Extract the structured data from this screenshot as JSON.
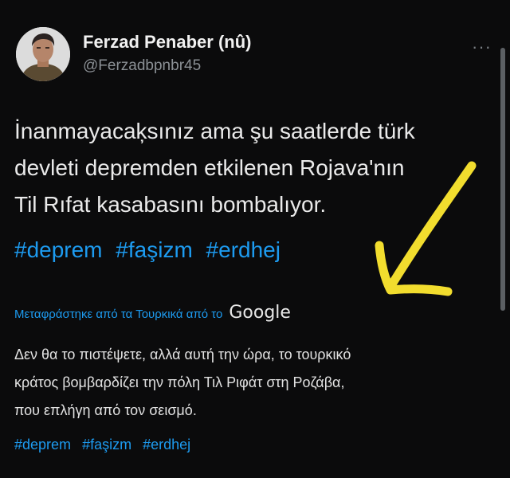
{
  "author": {
    "name": "Ferzad Penaber (nû)",
    "handle": "@Ferzadbpnbr45"
  },
  "menu": {
    "more_label": "···"
  },
  "tweet": {
    "lines": [
      "İnanmayacaķsınız ama şu saatlerde türk",
      "devleti depremden etkilenen Rojava'nın",
      "Til Rıfat kasabasını bombalıyor."
    ],
    "hashtags": [
      "#deprem",
      "#faşizm",
      "#erdhej"
    ]
  },
  "translation": {
    "source_label": "Μεταφράστηκε από τα Τουρκικά από το",
    "provider": "Google",
    "lines": [
      "Δεν θα το πιστέψετε, αλλά αυτή την ώρα, το τουρκικό",
      "κράτος βομβαρδίζει την πόλη Τιλ Ριφάτ στη Ροζάβα,",
      "που επλήγη από τον σεισμό."
    ],
    "hashtags": [
      "#deprem",
      "#faşizm",
      "#erdhej"
    ]
  },
  "colors": {
    "background": "#0b0b0c",
    "link": "#1d9bf0",
    "annotation_arrow": "#f2dd2e"
  },
  "icons": {
    "avatar": "profile-photo",
    "more": "more-horizontal-icon"
  }
}
